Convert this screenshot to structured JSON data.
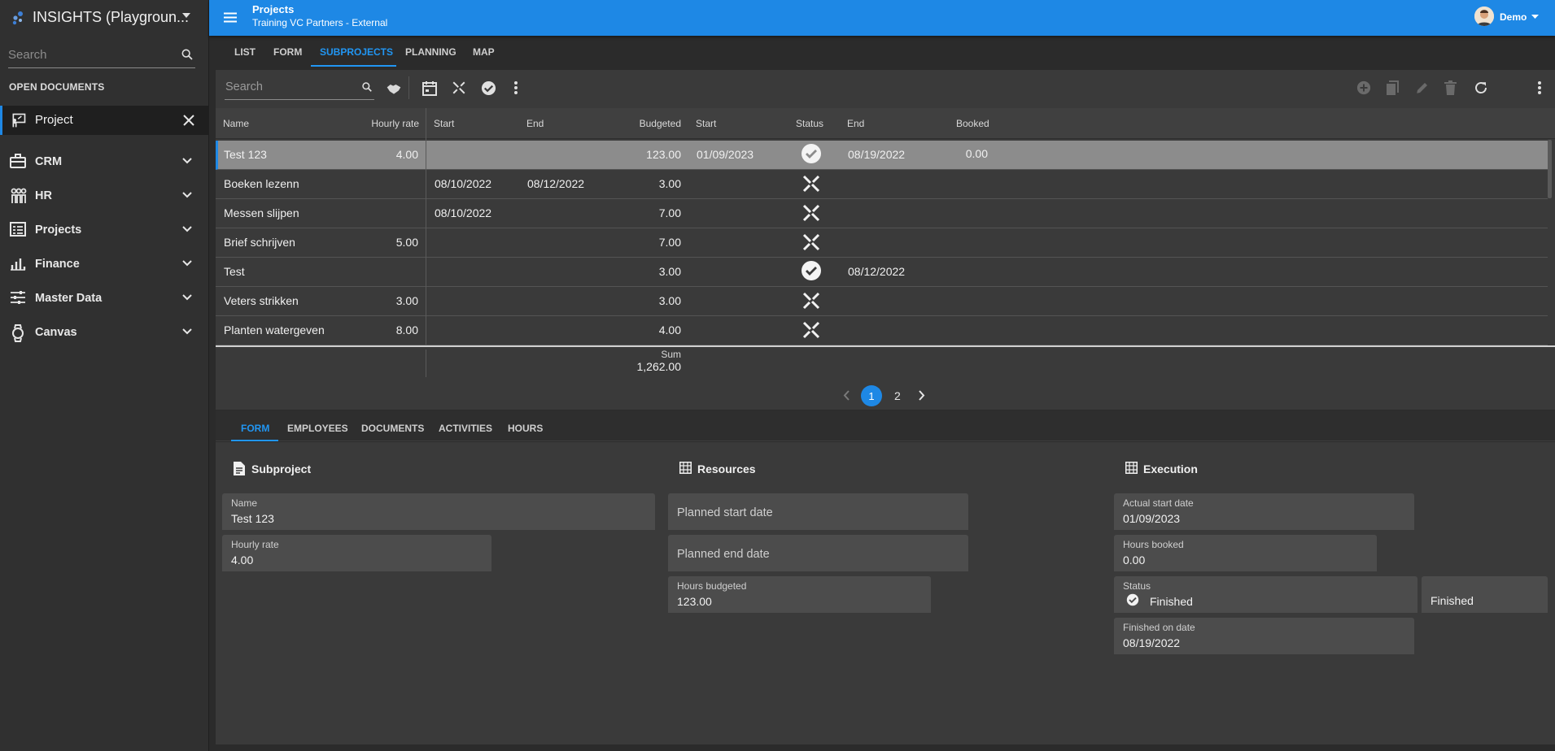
{
  "app": {
    "title": "INSIGHTS (Playgroun..."
  },
  "sidebar": {
    "search_placeholder": "Search",
    "open_documents_label": "OPEN DOCUMENTS",
    "open_document": "Project",
    "items": [
      {
        "label": "CRM",
        "icon": "briefcase-icon"
      },
      {
        "label": "HR",
        "icon": "people-icon"
      },
      {
        "label": "Projects",
        "icon": "projects-icon"
      },
      {
        "label": "Finance",
        "icon": "bar-chart-icon"
      },
      {
        "label": "Master Data",
        "icon": "sliders-icon"
      },
      {
        "label": "Canvas",
        "icon": "watch-icon"
      }
    ]
  },
  "header": {
    "title": "Projects",
    "subtitle": "Training VC Partners - External",
    "user": "Demo"
  },
  "top_tabs": [
    "LIST",
    "FORM",
    "SUBPROJECTS",
    "PLANNING",
    "MAP"
  ],
  "top_tabs_active": "SUBPROJECTS",
  "grid": {
    "search_placeholder": "Search",
    "columns": [
      "Name",
      "Hourly rate",
      "Start",
      "End",
      "Budgeted",
      "Start",
      "Status",
      "End",
      "Booked"
    ],
    "rows": [
      {
        "name": "Test 123",
        "rate": "4.00",
        "start": "",
        "end": "",
        "budgeted": "123.00",
        "start2": "01/09/2023",
        "status": "finished",
        "end2": "08/19/2022",
        "booked": "0.00"
      },
      {
        "name": "Boeken lezenn",
        "rate": "",
        "start": "08/10/2022",
        "end": "08/12/2022",
        "budgeted": "3.00",
        "start2": "",
        "status": "in-progress",
        "end2": "",
        "booked": ""
      },
      {
        "name": "Messen slijpen",
        "rate": "",
        "start": "08/10/2022",
        "end": "",
        "budgeted": "7.00",
        "start2": "",
        "status": "in-progress",
        "end2": "",
        "booked": ""
      },
      {
        "name": "Brief schrijven",
        "rate": "5.00",
        "start": "",
        "end": "",
        "budgeted": "7.00",
        "start2": "",
        "status": "in-progress",
        "end2": "",
        "booked": ""
      },
      {
        "name": "Test",
        "rate": "",
        "start": "",
        "end": "",
        "budgeted": "3.00",
        "start2": "",
        "status": "finished",
        "end2": "08/12/2022",
        "booked": ""
      },
      {
        "name": "Veters strikken",
        "rate": "3.00",
        "start": "",
        "end": "",
        "budgeted": "3.00",
        "start2": "",
        "status": "in-progress",
        "end2": "",
        "booked": ""
      },
      {
        "name": "Planten watergeven",
        "rate": "8.00",
        "start": "",
        "end": "",
        "budgeted": "4.00",
        "start2": "",
        "status": "in-progress",
        "end2": "",
        "booked": ""
      }
    ],
    "sum_label": "Sum",
    "sum_value": "1,262.00",
    "pages": [
      "1",
      "2"
    ],
    "current_page": "1"
  },
  "bottom_tabs": [
    "FORM",
    "EMPLOYEES",
    "DOCUMENTS",
    "ACTIVITIES",
    "HOURS"
  ],
  "bottom_tabs_active": "FORM",
  "form": {
    "subproject": {
      "title": "Subproject",
      "name_label": "Name",
      "name_value": "Test 123",
      "rate_label": "Hourly rate",
      "rate_value": "4.00"
    },
    "resources": {
      "title": "Resources",
      "planned_start_label": "Planned start date",
      "planned_end_label": "Planned end date",
      "hours_budgeted_label": "Hours budgeted",
      "hours_budgeted_value": "123.00"
    },
    "execution": {
      "title": "Execution",
      "actual_start_label": "Actual start date",
      "actual_start_value": "01/09/2023",
      "hours_booked_label": "Hours booked",
      "hours_booked_value": "0.00",
      "status_label": "Status",
      "status_value": "Finished",
      "status_text": "Finished",
      "finished_label": "Finished on date",
      "finished_value": "08/19/2022"
    }
  },
  "colors": {
    "accent": "#1e88e5",
    "background": "#2b2b2b",
    "panel": "#3a3a3a"
  }
}
